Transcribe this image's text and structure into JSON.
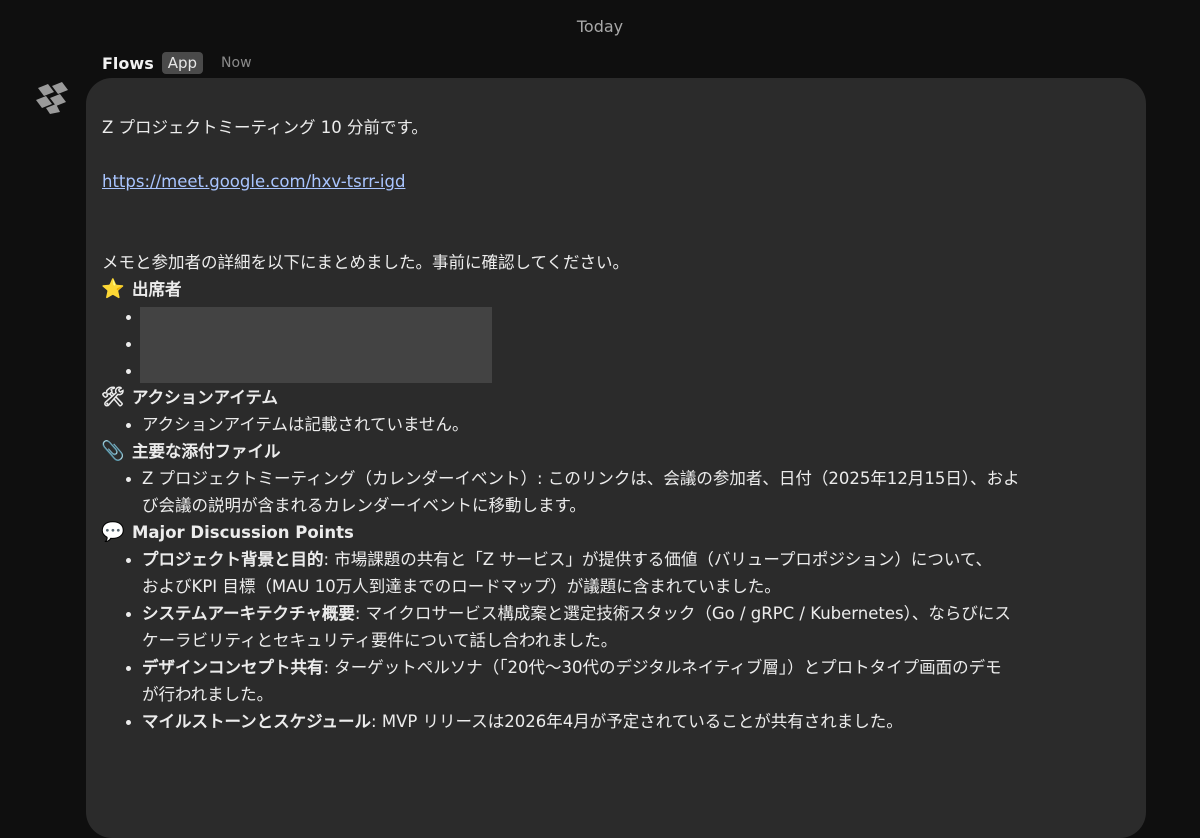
{
  "date_divider": "Today",
  "message": {
    "sender": "Flows",
    "badge": "App",
    "time": "Now"
  },
  "icons": {
    "avatar": "flows-logo-icon",
    "attendees": "star-icon",
    "actions": "hammer-wrench-icon",
    "attachments": "paperclip-icon",
    "discussion": "speech-bubble-icon"
  },
  "body": {
    "intro": "Z プロジェクトミーティング  10 分前です。",
    "meet_link": "https://meet.google.com/hxv-tsrr-igd",
    "summary": "メモと参加者の詳細を以下にまとめました。事前に確認してください。",
    "attendees_title": "出席者",
    "actions_title": "アクションアイテム",
    "actions_items": [
      "アクションアイテムは記載されていません。"
    ],
    "attachments_title": "主要な添付ファイル",
    "attachments_line1": "Z プロジェクトミーティング（カレンダーイベント）: このリンクは、会議の参加者、日付（2025年12月15日）、およ",
    "attachments_line2": "び会議の説明が含まれるカレンダーイベントに移動します。",
    "discussion_title": "Major Discussion Points",
    "discussion": [
      {
        "bold": "プロジェクト背景と目的",
        "line1": ": 市場課題の共有と「Z サービス」が提供する価値（バリュープロポジション）について、",
        "line2": "およびKPI 目標（MAU 10万人到達までのロードマップ）が議題に含まれていました。"
      },
      {
        "bold": "システムアーキテクチャ概要",
        "line1": ": マイクロサービス構成案と選定技術スタック（Go / gRPC / Kubernetes）、ならびにス",
        "line2": "ケーラビリティとセキュリティ要件について話し合われました。"
      },
      {
        "bold": "デザインコンセプト共有",
        "line1": ": ターゲットペルソナ（「20代〜30代のデジタルネイティブ層」）とプロトタイプ画面のデモ",
        "line2": "が行われました。"
      },
      {
        "bold": "マイルストーンとスケジュール",
        "line1": ": MVP リリースは2026年4月が予定されていることが共有されました。",
        "line2": ""
      }
    ]
  }
}
